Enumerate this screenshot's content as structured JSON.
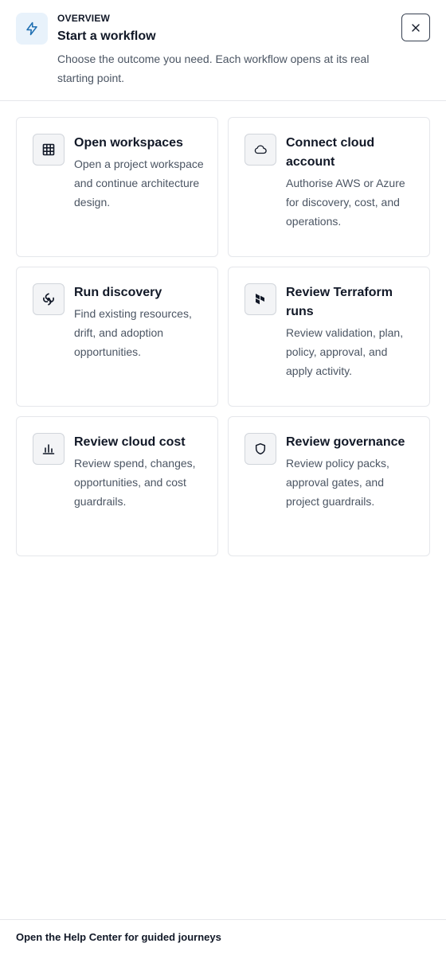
{
  "header": {
    "icon": "lightning-bolt-icon",
    "eyebrow": "OVERVIEW",
    "title": "Start a workflow",
    "subtitle": "Choose the outcome you need. Each workflow opens at its real starting point.",
    "close_icon": "close-icon",
    "accent_color": "#1f6fb2",
    "icon_bg_color": "#e8f2fb"
  },
  "workflows": [
    {
      "icon": "grid-icon",
      "title": "Open workspaces",
      "description": "Open a project workspace and continue architecture design."
    },
    {
      "icon": "cloud-icon",
      "title": "Connect cloud account",
      "description": "Authorise AWS or Azure for discovery, cost, and operations."
    },
    {
      "icon": "discovery-icon",
      "title": "Run discovery",
      "description": "Find existing resources, drift, and adoption opportunities."
    },
    {
      "icon": "terraform-icon",
      "title": "Review Terraform runs",
      "description": "Review validation, plan, policy, approval, and apply activity."
    },
    {
      "icon": "bar-chart-icon",
      "title": "Review cloud cost",
      "description": "Review spend, changes, opportunities, and cost guardrails."
    },
    {
      "icon": "shield-icon",
      "title": "Review governance",
      "description": "Review policy packs, approval gates, and project guardrails."
    }
  ],
  "footer": {
    "link_label": "Open the Help Center for guided journeys"
  }
}
